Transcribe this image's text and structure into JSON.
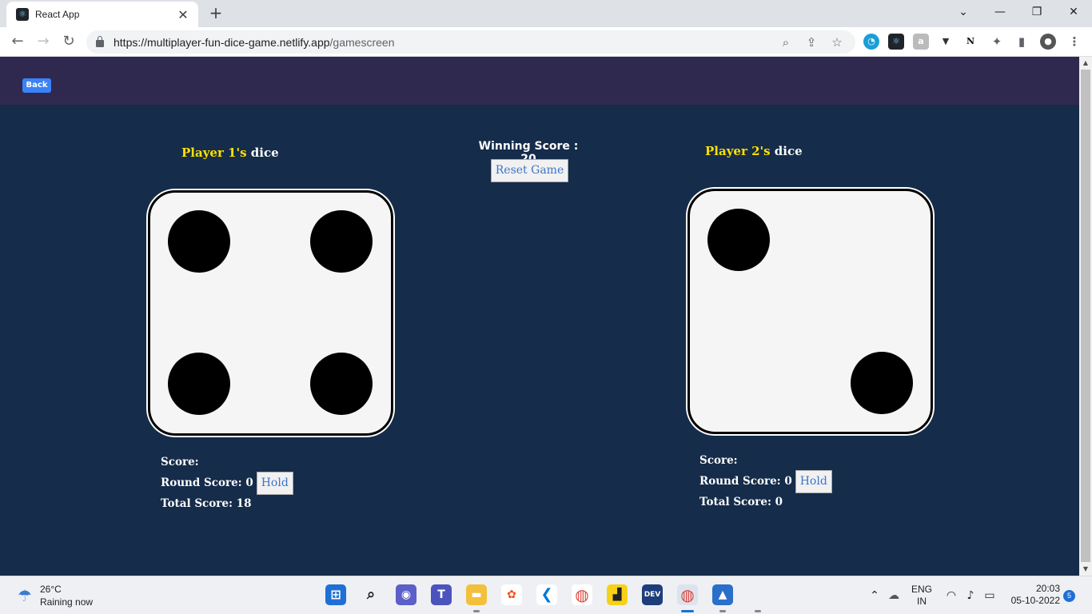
{
  "browser": {
    "tab_title": "React App",
    "tab_close": "✕",
    "new_tab": "+",
    "url_host": "https://multiplayer-fun-dice-game.netlify.app",
    "url_path": "/gamescreen",
    "window_controls": {
      "minimize": "—",
      "maximize": "❐",
      "close": "✕",
      "tab_search": "⌄"
    },
    "extensions": [
      "N"
    ]
  },
  "game": {
    "back_label": "Back",
    "winning_score_label": "Winning Score : 20",
    "reset_label": "Reset Game",
    "player1": {
      "name": "Player 1's",
      "dice_word": "dice",
      "die_face": 4,
      "score_label": "Score:",
      "round_score_label": "Round Score: 0",
      "hold_label": "Hold",
      "total_score_label": "Total Score: 18"
    },
    "player2": {
      "name": "Player 2's",
      "dice_word": "dice",
      "die_face": 2,
      "score_label": "Score:",
      "round_score_label": "Round Score: 0",
      "hold_label": "Hold",
      "total_score_label": "Total Score: 0"
    }
  },
  "taskbar": {
    "weather_temp": "26°C",
    "weather_desc": "Raining now",
    "lang_line1": "ENG",
    "lang_line2": "IN",
    "time": "20:03",
    "date": "05-10-2022",
    "notifications": "5"
  }
}
